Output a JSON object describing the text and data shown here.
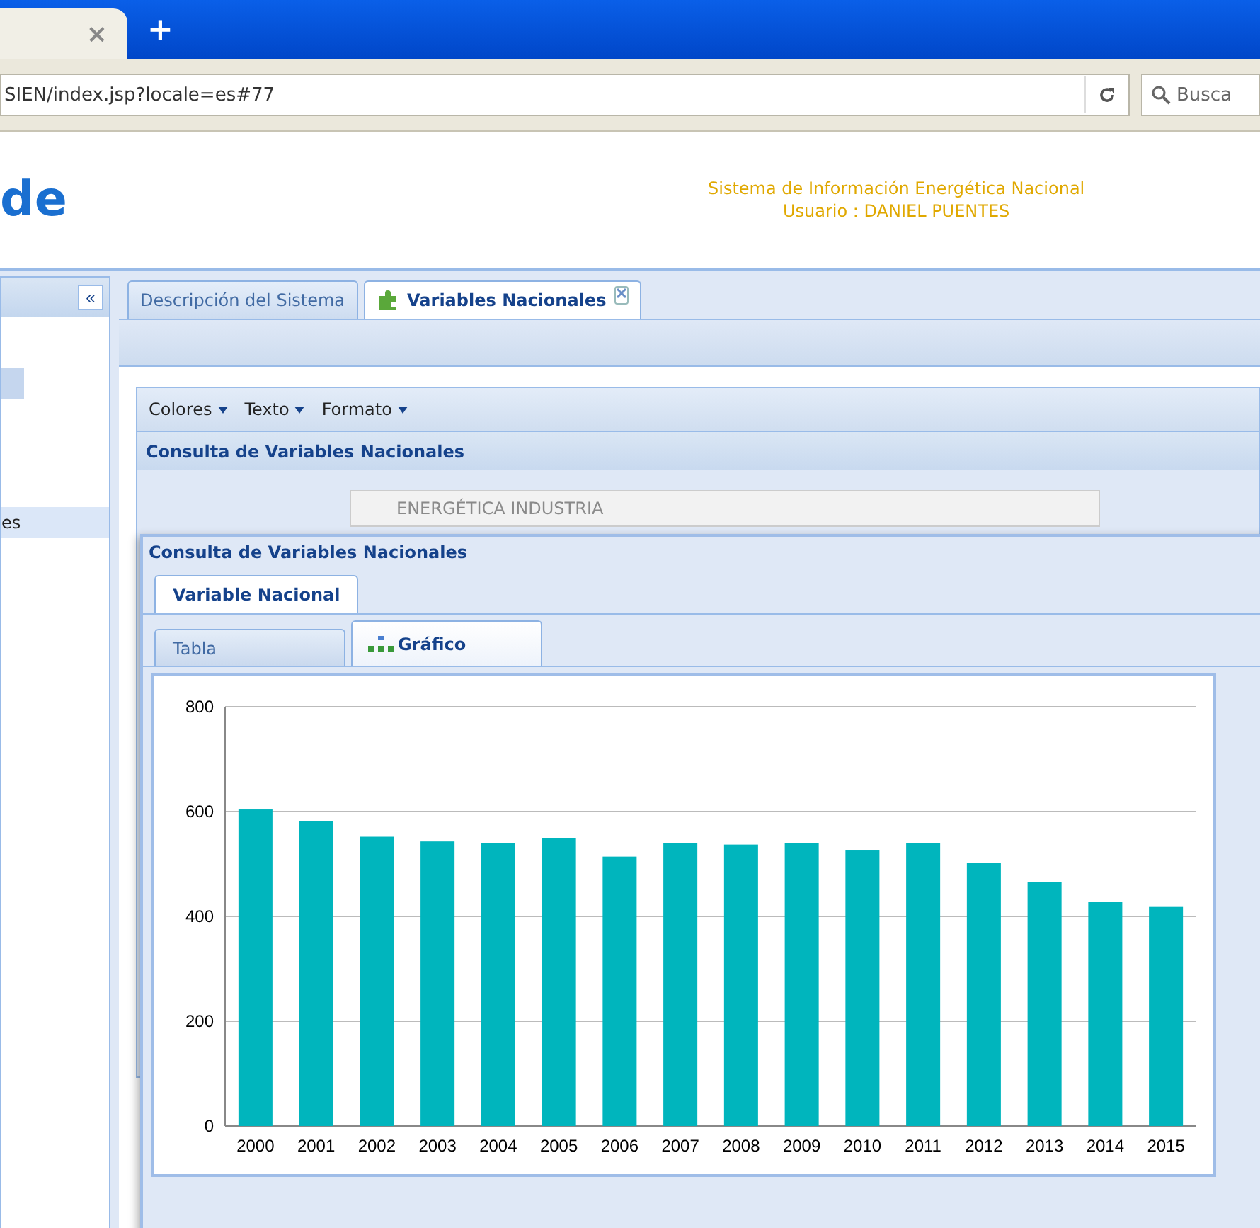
{
  "browser": {
    "tab_close": "×",
    "new_tab": "+",
    "url": "SIEN/index.jsp?locale=es#77",
    "search_placeholder": "Busca"
  },
  "header": {
    "logo": "de",
    "system_title": "Sistema de Información Energética Nacional",
    "user": "Usuario : DANIEL PUENTES"
  },
  "sidebar": {
    "collapse": "«",
    "items": [
      {
        "selected": false
      },
      {
        "label": "es",
        "selected": true
      }
    ]
  },
  "tabs": [
    {
      "label": "Descripción del Sistema",
      "selected": false,
      "closable": false
    },
    {
      "label": "Variables Nacionales",
      "selected": true,
      "closable": true
    }
  ],
  "menus": [
    "Colores",
    "Texto",
    "Formato"
  ],
  "panel_title": "Consulta de Variables Nacionales",
  "variable_field": {
    "value": "ENERGÉTICA INDUSTRIA"
  },
  "window": {
    "title": "Consulta de Variables Nacionales",
    "tabs": [
      {
        "label": "Variable Nacional",
        "selected": true
      }
    ],
    "subtabs": [
      {
        "label": "Tabla",
        "selected": false
      },
      {
        "label": "Gráfico",
        "selected": true
      }
    ],
    "chart_data": {
      "type": "bar",
      "categories": [
        "2000",
        "2001",
        "2002",
        "2003",
        "2004",
        "2005",
        "2006",
        "2007",
        "2008",
        "2009",
        "2010",
        "2011",
        "2012",
        "2013",
        "2014",
        "2015"
      ],
      "series": [
        {
          "color": "#00b5bd",
          "values": [
            604,
            582,
            552,
            543,
            540,
            550,
            514,
            540,
            537,
            540,
            527,
            540,
            502,
            466,
            428,
            418
          ]
        }
      ],
      "grid": true,
      "ylim": [
        0,
        800
      ],
      "yticks": [
        0,
        200,
        400,
        600,
        800
      ]
    }
  }
}
